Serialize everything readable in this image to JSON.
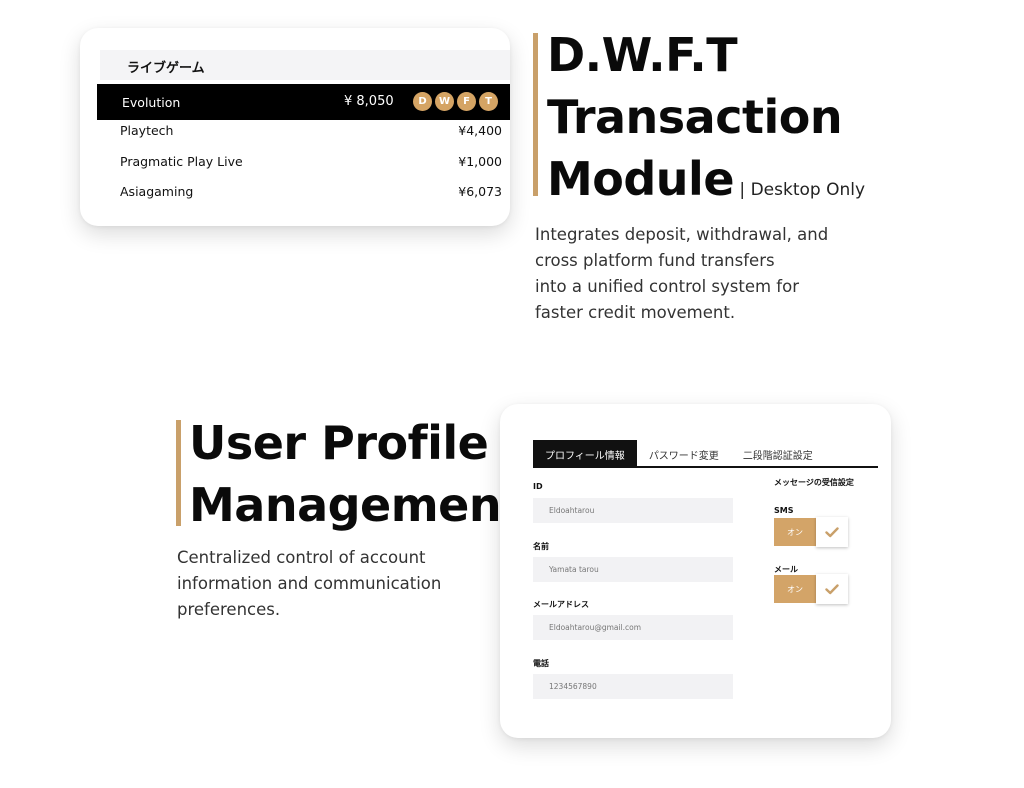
{
  "live_game": {
    "header": "ライブゲーム",
    "active": {
      "name": "Evolution",
      "amount": "¥ 8,050",
      "badges": [
        "D",
        "W",
        "F",
        "T"
      ]
    },
    "rows": [
      {
        "name": "Playtech",
        "amount": "¥4,400"
      },
      {
        "name": "Pragmatic Play Live",
        "amount": "¥1,000"
      },
      {
        "name": "Asiagaming",
        "amount": "¥6,073"
      }
    ]
  },
  "dwft": {
    "title_line1": "D.W.F.T",
    "title_line2": "Transaction",
    "title_line3": "Module",
    "suffix": " | Desktop Only",
    "desc_lines": [
      "Integrates deposit, withdrawal, and",
      "cross platform fund transfers",
      "into a unified control system for",
      "faster credit movement."
    ]
  },
  "profile": {
    "title_line1": "User Profile",
    "title_line2": "Management",
    "desc_lines": [
      "Centralized control of account",
      "information and communication",
      "preferences."
    ]
  },
  "profile_card": {
    "tabs": [
      "プロフィール情報",
      "パスワード変更",
      "二段階認証設定"
    ],
    "fields": [
      {
        "label": "ID",
        "value": "Eldoahtarou"
      },
      {
        "label": "名前",
        "value": "Yamata tarou"
      },
      {
        "label": "メールアドレス",
        "value": "Eldoahtarou@gmail.com"
      },
      {
        "label": "電話",
        "value": "1234567890"
      }
    ],
    "message_settings_title": "メッセージの受信設定",
    "toggles": [
      {
        "label": "SMS",
        "state": "オン"
      },
      {
        "label": "メール",
        "state": "オン"
      }
    ]
  },
  "colors": {
    "accent": "#c9a06a",
    "badge": "#d5a464",
    "toggle_on": "#d3a468"
  }
}
